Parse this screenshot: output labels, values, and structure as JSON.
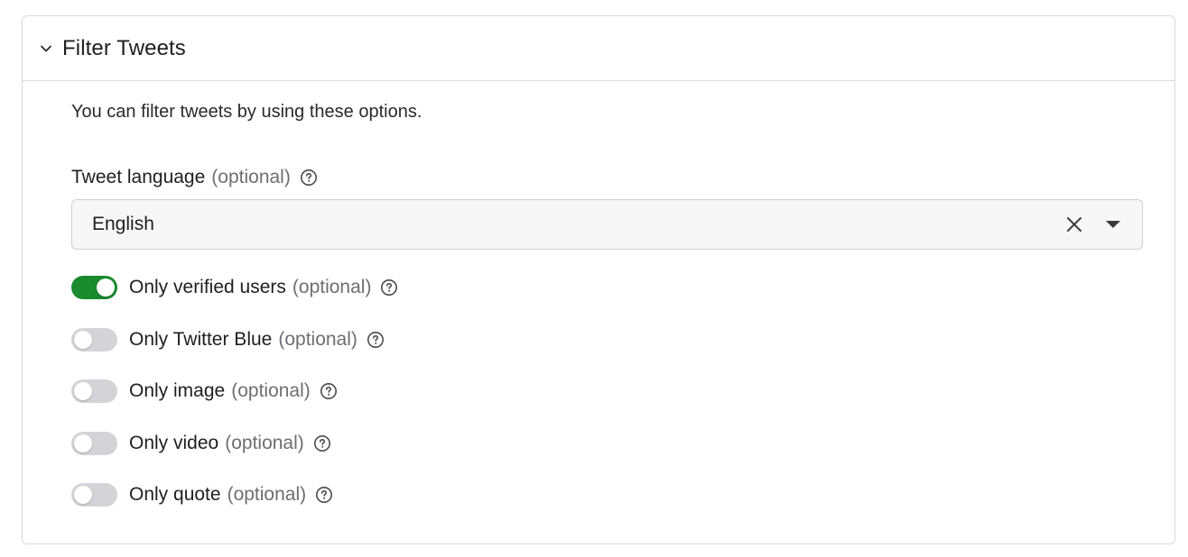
{
  "panel": {
    "title": "Filter Tweets",
    "expanded": true,
    "description": "You can filter tweets by using these options."
  },
  "language_field": {
    "label": "Tweet language",
    "optional": "(optional)",
    "value": "English"
  },
  "toggles": [
    {
      "label": "Only verified users",
      "optional": "(optional)",
      "on": true
    },
    {
      "label": "Only Twitter Blue",
      "optional": "(optional)",
      "on": false
    },
    {
      "label": "Only image",
      "optional": "(optional)",
      "on": false
    },
    {
      "label": "Only video",
      "optional": "(optional)",
      "on": false
    },
    {
      "label": "Only quote",
      "optional": "(optional)",
      "on": false
    }
  ],
  "icons": {
    "chevron": "chevron-down-icon",
    "help": "question-circle-icon",
    "clear": "close-icon",
    "caret": "caret-down-icon"
  },
  "colors": {
    "toggle_on": "#1a8a2e",
    "toggle_off": "#d4d4d8",
    "optional_text": "#6e6e73",
    "border": "#d9d9de"
  }
}
